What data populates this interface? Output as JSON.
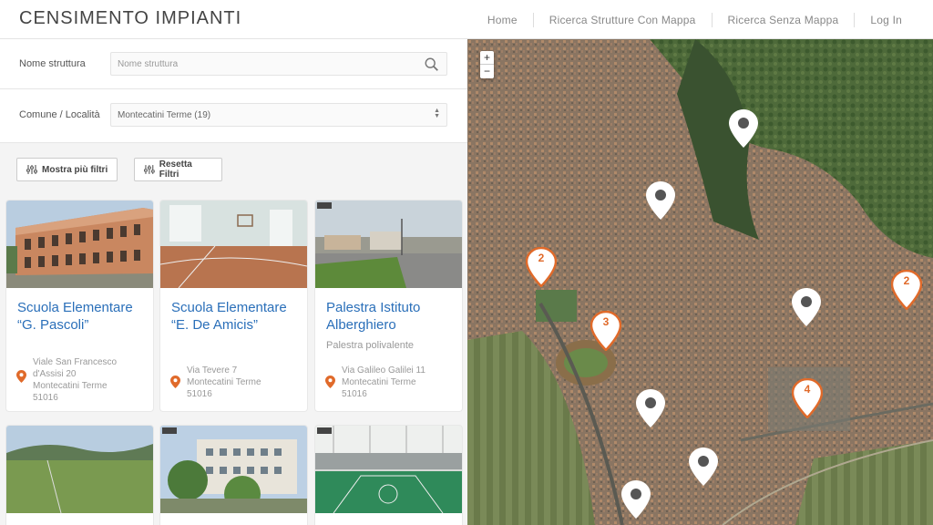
{
  "header": {
    "brand": "CENSIMENTO IMPIANTI",
    "nav": [
      "Home",
      "Ricerca Strutture Con Mappa",
      "Ricerca Senza Mappa",
      "Log In"
    ]
  },
  "filters": {
    "name_label": "Nome struttura",
    "name_placeholder": "Nome struttura",
    "comune_label": "Comune / Località",
    "comune_value": "Montecatini Terme (19)",
    "more_filters": "Mostra più filtri",
    "reset_filters": "Resetta Filtri"
  },
  "cards": [
    {
      "title": "Scuola Elementare “G. Pascoli”",
      "subtitle": "",
      "address": [
        "Viale San Francesco",
        "d'Assisi 20",
        "Montecatini Terme",
        "51016"
      ]
    },
    {
      "title": "Scuola Elementare “E. De Amicis”",
      "subtitle": "",
      "address": [
        "Via Tevere 7",
        "Montecatini Terme",
        "51016"
      ]
    },
    {
      "title": "Palestra Istituto Alberghiero",
      "subtitle": "Palestra polivalente",
      "address": [
        "Via Galileo Galilei 11",
        "Montecatini Terme",
        "51016"
      ]
    }
  ],
  "map": {
    "zoom_in": "+",
    "zoom_out": "−",
    "markers": [
      {
        "type": "cluster",
        "count": "2"
      },
      {
        "type": "cluster",
        "count": "3"
      },
      {
        "type": "cluster",
        "count": "2"
      },
      {
        "type": "cluster",
        "count": "4"
      },
      {
        "type": "pin"
      },
      {
        "type": "pin"
      },
      {
        "type": "pin"
      },
      {
        "type": "pin"
      },
      {
        "type": "pin"
      },
      {
        "type": "pin"
      }
    ]
  },
  "colors": {
    "accent": "#2a6fb9",
    "marker_orange": "#e06a2a",
    "pin_grey": "#555555"
  }
}
